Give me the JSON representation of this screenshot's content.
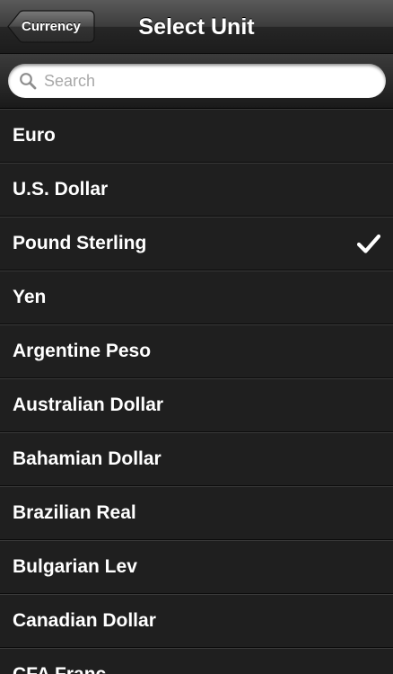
{
  "navbar": {
    "back_label": "Currency",
    "title": "Select Unit"
  },
  "search": {
    "placeholder": "Search",
    "value": ""
  },
  "list": {
    "items": [
      {
        "label": "Euro",
        "selected": false
      },
      {
        "label": "U.S. Dollar",
        "selected": false
      },
      {
        "label": "Pound Sterling",
        "selected": true
      },
      {
        "label": "Yen",
        "selected": false
      },
      {
        "label": "Argentine Peso",
        "selected": false
      },
      {
        "label": "Australian Dollar",
        "selected": false
      },
      {
        "label": "Bahamian Dollar",
        "selected": false
      },
      {
        "label": "Brazilian Real",
        "selected": false
      },
      {
        "label": "Bulgarian Lev",
        "selected": false
      },
      {
        "label": "Canadian Dollar",
        "selected": false
      },
      {
        "label": "CFA Franc",
        "selected": false
      }
    ]
  },
  "icons": {
    "search": "search-icon",
    "selected": "checkmark-icon",
    "back": "back-arrow-shape"
  },
  "colors": {
    "background": "#1f1f1f",
    "text": "#ffffff",
    "placeholder": "#a8a8a8"
  }
}
